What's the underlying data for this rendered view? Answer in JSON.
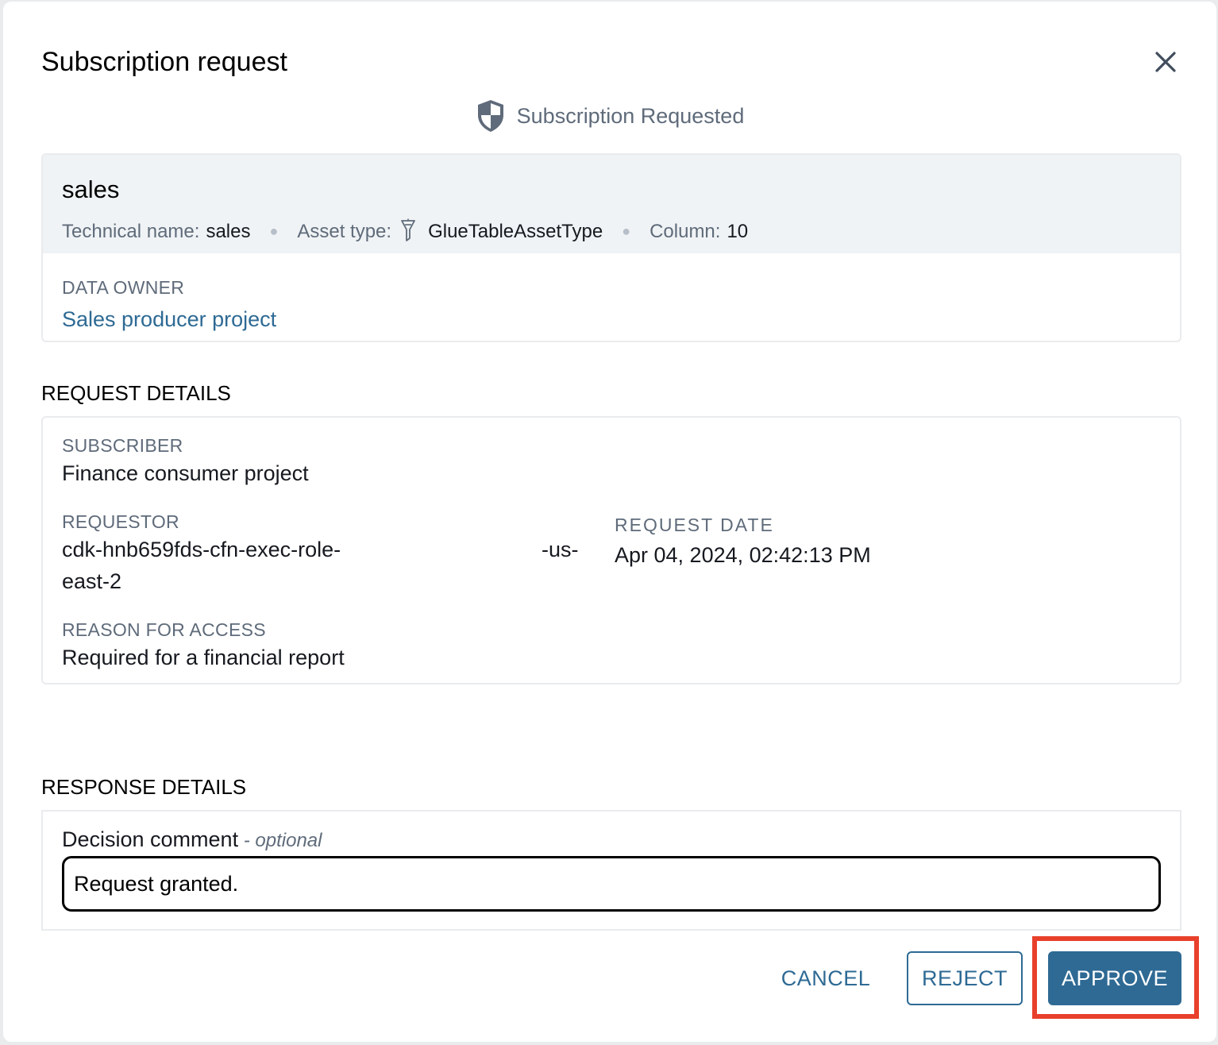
{
  "dialog": {
    "title": "Subscription request",
    "status": "Subscription Requested"
  },
  "asset": {
    "name": "sales",
    "technical_name_label": "Technical name:",
    "technical_name": "sales",
    "asset_type_label": "Asset type:",
    "asset_type": "GlueTableAssetType",
    "column_label": "Column:",
    "column_count": "10",
    "data_owner_label": "DATA OWNER",
    "data_owner": "Sales producer project"
  },
  "request": {
    "section_title": "REQUEST DETAILS",
    "subscriber_label": "SUBSCRIBER",
    "subscriber": "Finance consumer project",
    "requestor_label": "REQUESTOR",
    "requestor_line1": "cdk-hnb659fds-cfn-exec-role-",
    "requestor_mid": "-us-",
    "requestor_line2": "east-2",
    "request_date_label": "REQUEST DATE",
    "request_date": "Apr 04, 2024, 02:42:13 PM",
    "reason_label": "REASON FOR ACCESS",
    "reason": "Required for a financial report"
  },
  "response": {
    "section_title": "RESPONSE DETAILS",
    "comment_label": "Decision comment",
    "comment_optional": " - optional",
    "comment_value": "Request granted."
  },
  "actions": {
    "cancel_label": "CANCEL",
    "reject_label": "REJECT",
    "approve_label": "APPROVE"
  },
  "colors": {
    "accent": "#2e6a94",
    "highlight": "#e8402c",
    "asset_header_bg": "#f0f3f5"
  },
  "icons": {
    "close": "close-icon",
    "status": "shield-icon",
    "asset_type": "glue-table-icon"
  }
}
